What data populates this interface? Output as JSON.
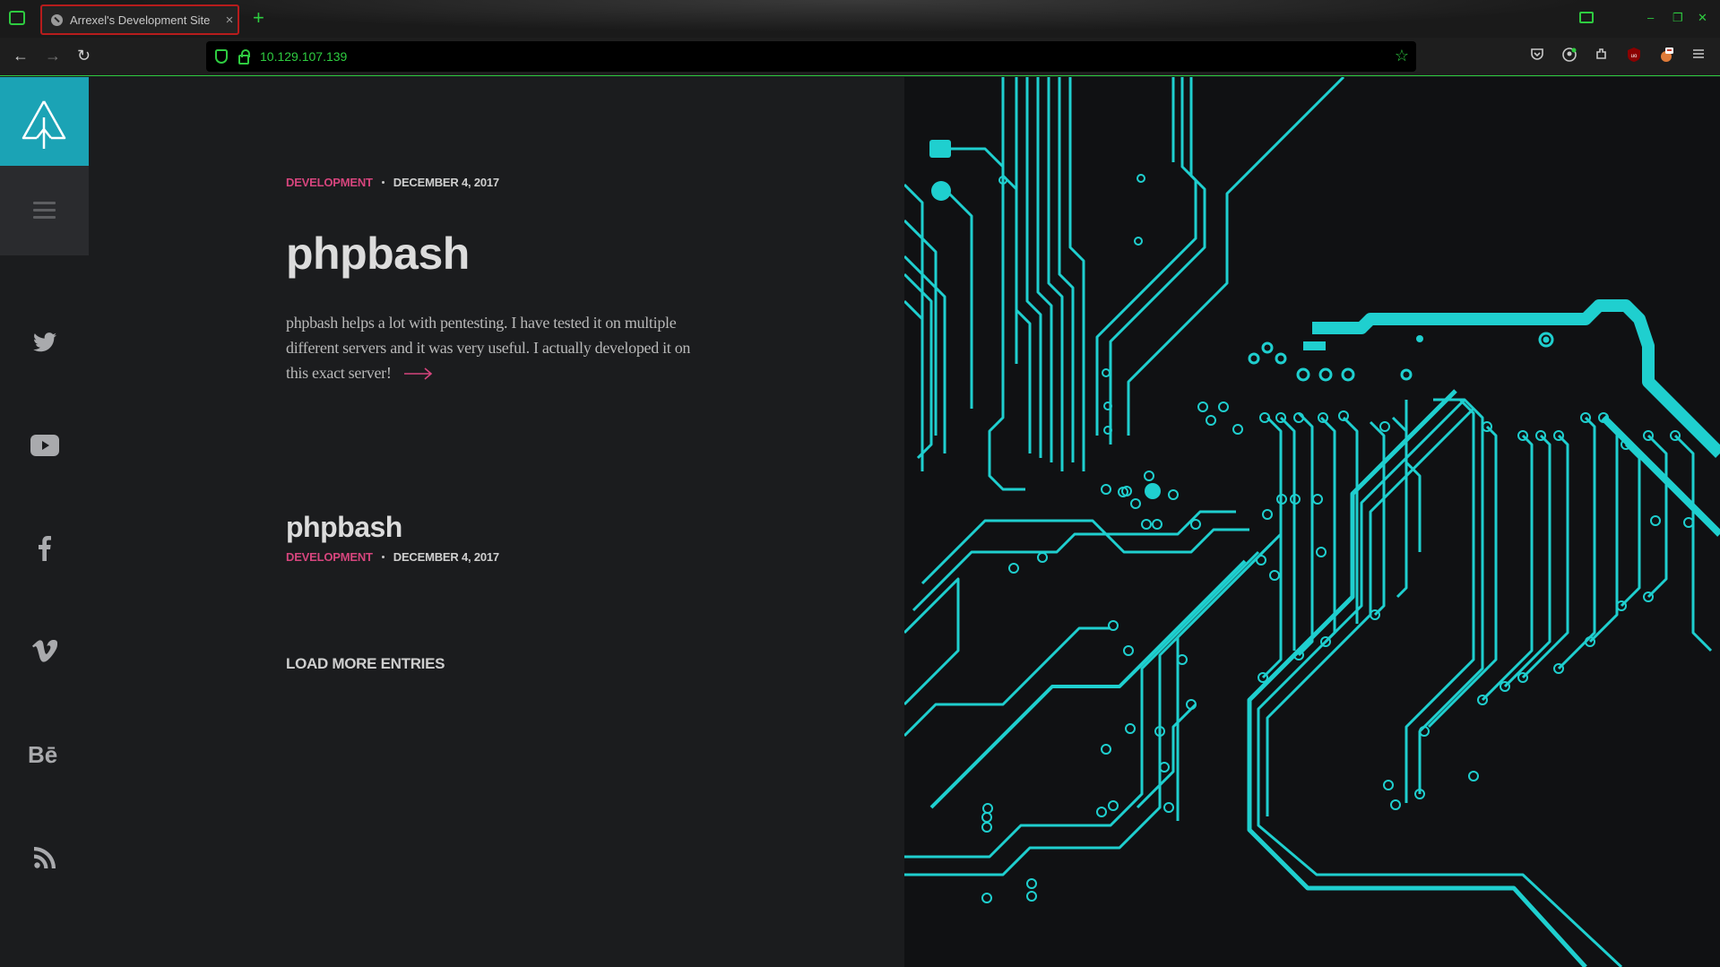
{
  "browser": {
    "tab": {
      "title": "Arrexel's Development Site",
      "close_glyph": "×",
      "favicon": "site-icon"
    },
    "new_tab_glyph": "+",
    "url": "10.129.107.139",
    "nav": {
      "back": "←",
      "forward": "→",
      "reload": "↻"
    },
    "window_controls": {
      "minimize": "–",
      "maximize": "❐",
      "close": "✕"
    },
    "accent_color": "#2ecc40"
  },
  "sidebar": {
    "logo_icon": "arrow-tree-logo",
    "menu_icon": "hamburger-icon",
    "social": [
      "twitter-icon",
      "youtube-icon",
      "facebook-icon",
      "vimeo-icon",
      "behance-icon",
      "rss-icon"
    ],
    "logo_color": "#1ba3b5"
  },
  "posts": [
    {
      "category": "DEVELOPMENT",
      "date": "DECEMBER 4, 2017",
      "title": "phpbash",
      "excerpt": "phpbash helps a lot with pentesting. I have tested it on multiple different servers and it was very useful. I actually developed it on this exact server!"
    },
    {
      "title": "phpbash",
      "category": "DEVELOPMENT",
      "date": "DECEMBER 4, 2017"
    }
  ],
  "load_more": "LOAD MORE ENTRIES",
  "colors": {
    "category": "#d6457d",
    "circuit": "#1fcfcf",
    "background": "#1b1c1e"
  }
}
